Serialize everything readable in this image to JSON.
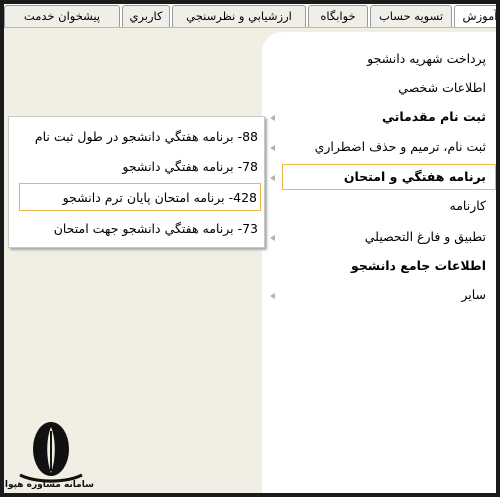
{
  "tabs": [
    {
      "label": "آموزش",
      "active": true
    },
    {
      "label": "تسويه حساب",
      "active": false
    },
    {
      "label": "خوابگاه",
      "active": false
    },
    {
      "label": "ارزشيابي و نظرسنجي",
      "active": false
    },
    {
      "label": "كاربري",
      "active": false
    },
    {
      "label": "پيشخوان خدمت",
      "active": false
    }
  ],
  "menu": {
    "items": [
      {
        "label": "پرداخت شهريه دانشجو",
        "bold": false,
        "has_submenu": false
      },
      {
        "label": "اطلاعات شخصي",
        "bold": false,
        "has_submenu": false
      },
      {
        "label": "ثبت نام مقدماتي",
        "bold": true,
        "has_submenu": true
      },
      {
        "label": "ثبت نام، ترميم و حذف اضطراري",
        "bold": false,
        "has_submenu": true
      },
      {
        "label": "برنامه هفتگي و امتحان",
        "bold": true,
        "has_submenu": true,
        "selected": true
      },
      {
        "label": "کارنامه",
        "bold": false,
        "has_submenu": false
      },
      {
        "label": "تطبيق و فارغ التحصيلي",
        "bold": false,
        "has_submenu": true
      },
      {
        "label": "اطلاعات جامع دانشجو",
        "bold": true,
        "has_submenu": false
      },
      {
        "label": "ساير",
        "bold": false,
        "has_submenu": true
      }
    ]
  },
  "submenu": {
    "items": [
      {
        "label": "88- برنامه هفتگي دانشجو در طول ثبت نام",
        "active": false
      },
      {
        "label": "78- برنامه هفتگي دانشجو",
        "active": false
      },
      {
        "label": "428- برنامه امتحان پايان ترم دانشجو",
        "active": true
      },
      {
        "label": "73- برنامه هفتگي دانشجو جهت امتحان",
        "active": false
      }
    ]
  },
  "logo": {
    "caption": "سامانه مشاوره هپوا",
    "icon": "pen-nib-logo-icon"
  },
  "colors": {
    "highlight_border": "#f0b84a",
    "left_panel": "#f1efe4",
    "submenu_arrow": "#b0b0b0"
  }
}
